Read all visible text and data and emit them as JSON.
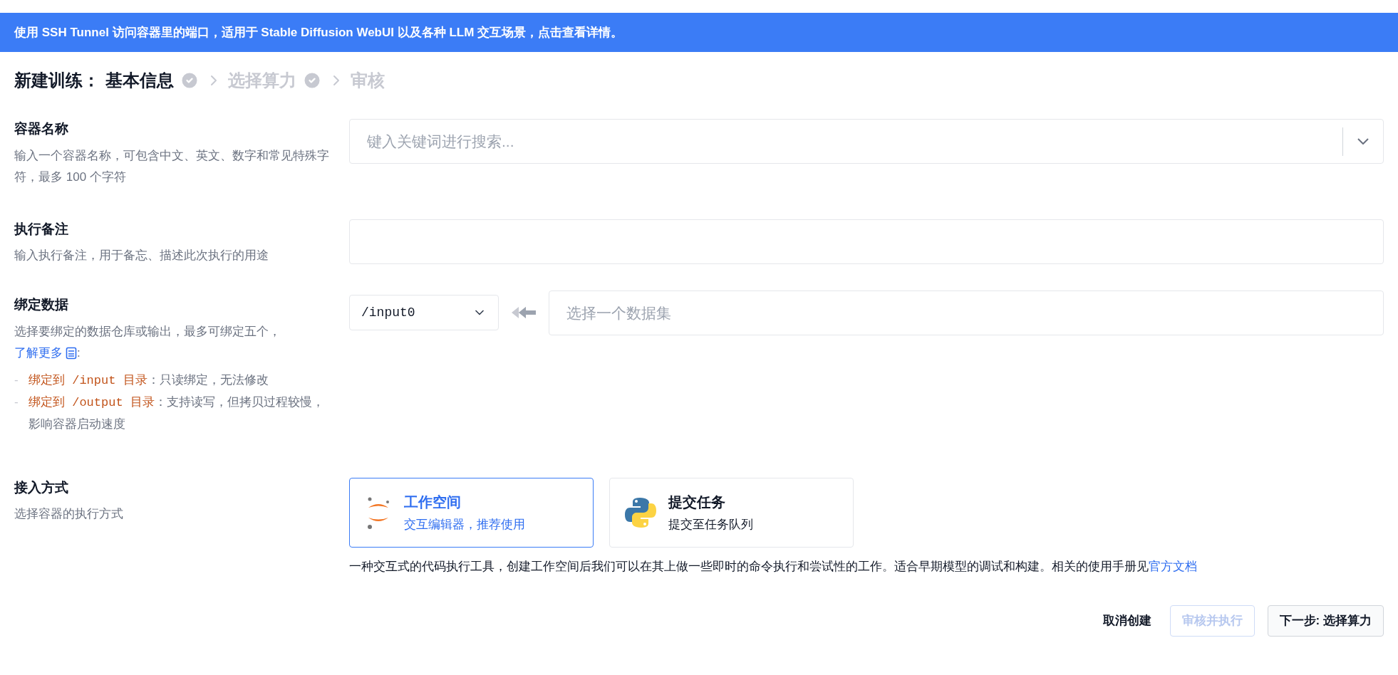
{
  "banner": "使用 SSH Tunnel 访问容器里的端口，适用于 Stable Diffusion WebUI 以及各种 LLM 交互场景，点击查看详情。",
  "header": {
    "title": "新建训练：",
    "steps": [
      {
        "label": "基本信息",
        "selected": true,
        "done": true
      },
      {
        "label": "选择算力",
        "selected": false,
        "done": true
      },
      {
        "label": "审核",
        "selected": false,
        "done": false
      }
    ]
  },
  "container_name": {
    "label": "容器名称",
    "hint": "输入一个容器名称，可包含中文、英文、数字和常见特殊字符，最多 100 个字符",
    "placeholder": "键入关键词进行搜索..."
  },
  "remark": {
    "label": "执行备注",
    "hint": "输入执行备注，用于备忘、描述此次执行的用途"
  },
  "bind_data": {
    "label": "绑定数据",
    "hint": "选择要绑定的数据仓库或输出，最多可绑定五个，",
    "link": "了解更多",
    "after_link": ":",
    "rules": [
      {
        "marker": "-",
        "highlight": "绑定到 /input 目录",
        "text": "：只读绑定，无法修改"
      },
      {
        "marker": "-",
        "highlight": "绑定到 /output 目录",
        "text": "：支持读写，但拷贝过程较慢，影响容器启动速度"
      }
    ],
    "mount": "/input0",
    "dataset_placeholder": "选择一个数据集"
  },
  "access": {
    "label": "接入方式",
    "hint": "选择容器的执行方式",
    "options": [
      {
        "kind": "jupyter",
        "title": "工作空间",
        "subtitle": "交互编辑器，推荐使用",
        "selected": true
      },
      {
        "kind": "python",
        "title": "提交任务",
        "subtitle": "提交至任务队列",
        "selected": false
      }
    ],
    "description": "一种交互式的代码执行工具，创建工作空间后我们可以在其上做一些即时的命令执行和尝试性的工作。适合早期模型的调试和构建。相关的使用手册见",
    "doc_link": "官方文档"
  },
  "buttons": [
    {
      "kind": "text",
      "label": "取消创建",
      "disabled": false
    },
    {
      "kind": "outline",
      "label": "审核并执行",
      "disabled": true
    },
    {
      "kind": "default",
      "label": "下一步: 选择算力",
      "disabled": false
    }
  ]
}
